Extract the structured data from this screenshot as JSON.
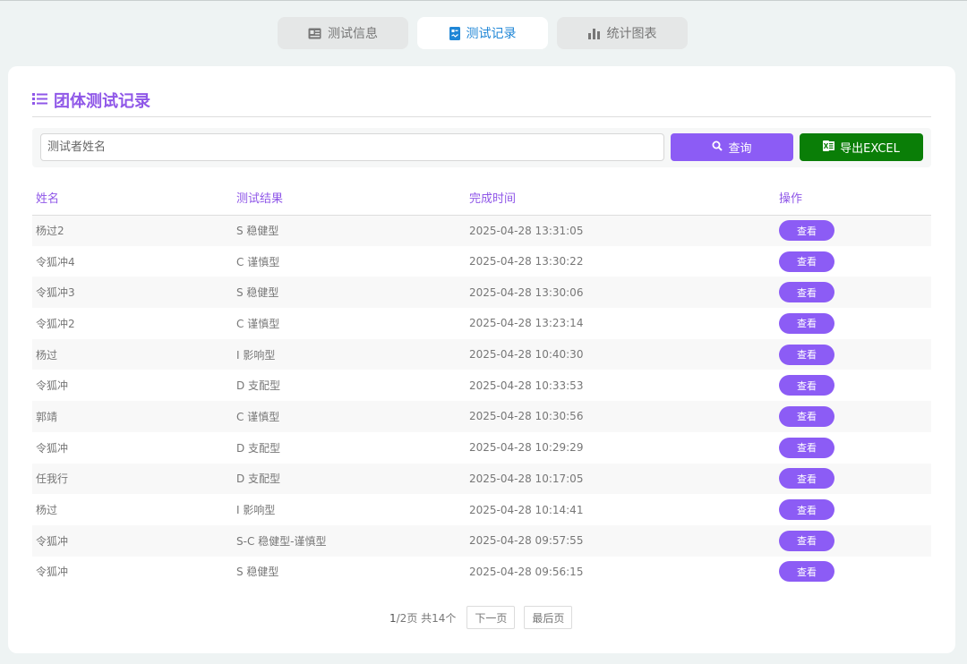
{
  "tabs": [
    {
      "label": "测试信息",
      "icon": "id-card-icon",
      "active": false
    },
    {
      "label": "测试记录",
      "icon": "record-icon",
      "active": true
    },
    {
      "label": "统计图表",
      "icon": "bar-chart-icon",
      "active": false
    }
  ],
  "page": {
    "title": "团体测试记录",
    "title_icon": "list-icon"
  },
  "search": {
    "placeholder": "测试者姓名",
    "value": "",
    "query_label": "查询",
    "export_label": "导出EXCEL"
  },
  "table": {
    "headers": [
      "姓名",
      "测试结果",
      "完成时间",
      "操作"
    ],
    "view_label": "查看",
    "rows": [
      {
        "name": "杨过2",
        "result": "S 稳健型",
        "time": "2025-04-28 13:31:05"
      },
      {
        "name": "令狐冲4",
        "result": "C 谨慎型",
        "time": "2025-04-28 13:30:22"
      },
      {
        "name": "令狐冲3",
        "result": "S 稳健型",
        "time": "2025-04-28 13:30:06"
      },
      {
        "name": "令狐冲2",
        "result": "C 谨慎型",
        "time": "2025-04-28 13:23:14"
      },
      {
        "name": "杨过",
        "result": "I 影响型",
        "time": "2025-04-28 10:40:30"
      },
      {
        "name": "令狐冲",
        "result": "D 支配型",
        "time": "2025-04-28 10:33:53"
      },
      {
        "name": "郭靖",
        "result": "C 谨慎型",
        "time": "2025-04-28 10:30:56"
      },
      {
        "name": "令狐冲",
        "result": "D 支配型",
        "time": "2025-04-28 10:29:29"
      },
      {
        "name": "任我行",
        "result": "D 支配型",
        "time": "2025-04-28 10:17:05"
      },
      {
        "name": "杨过",
        "result": "I 影响型",
        "time": "2025-04-28 10:14:41"
      },
      {
        "name": "令狐冲",
        "result": "S-C 稳健型-谨慎型",
        "time": "2025-04-28 09:57:55"
      },
      {
        "name": "令狐冲",
        "result": "S 稳健型",
        "time": "2025-04-28 09:56:15"
      }
    ]
  },
  "pagination": {
    "current": "1",
    "rest": "/2页 共14个",
    "next_label": "下一页",
    "last_label": "最后页"
  },
  "colors": {
    "accent": "#8c5cf5",
    "title": "#8f57e8",
    "export": "#0a7e07",
    "active_tab_text": "#1f86d6"
  }
}
